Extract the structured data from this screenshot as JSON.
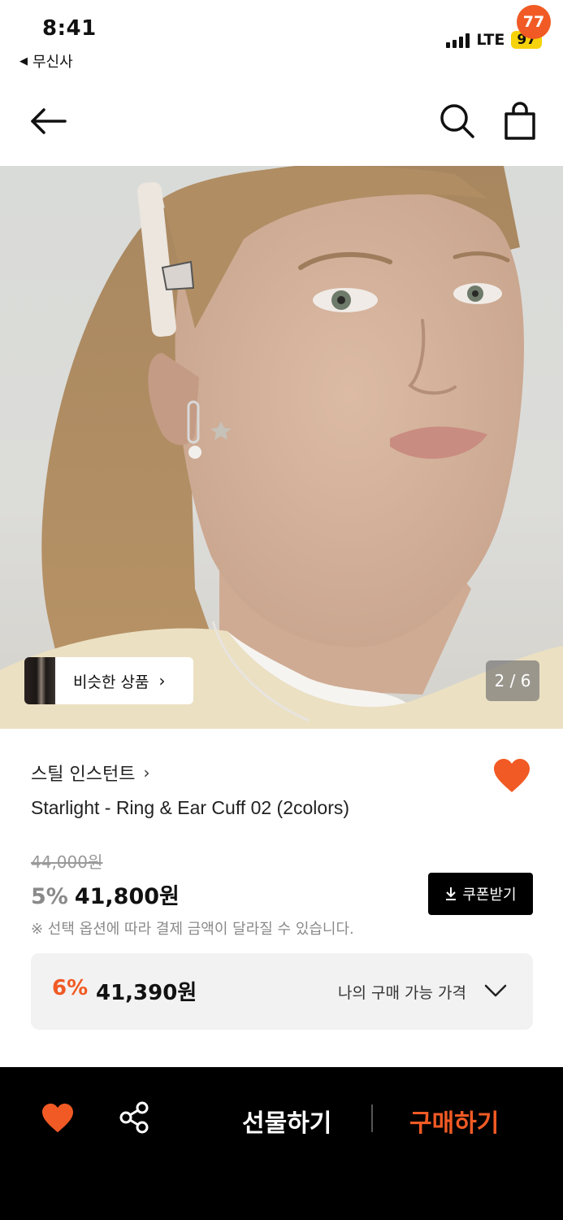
{
  "status_bar": {
    "time": "8:41",
    "back_app": "무신사",
    "network": "LTE",
    "battery": "97"
  },
  "nav": {
    "cart_badge": "77",
    "icons": [
      "back-arrow-icon",
      "search-icon",
      "shopping-bag-icon"
    ]
  },
  "gallery": {
    "similar_label": "비슷한 상품",
    "counter": "2 / 6"
  },
  "product": {
    "brand": "스틸 인스턴트",
    "title": "Starlight - Ring & Ear Cuff 02 (2colors)",
    "original_price": "44,000원",
    "discount_rate": "5%",
    "sale_price": "41,800원",
    "coupon_label": "쿠폰받기",
    "notice": "※ 선택 옵션에 따라 결제 금액이 달라질 수 있습니다."
  },
  "my_price": {
    "rate": "6%",
    "price": "41,390원",
    "label": "나의 구매 가능 가격"
  },
  "bottom_bar": {
    "gift_label": "선물하기",
    "buy_label": "구매하기"
  },
  "colors": {
    "accent": "#f15a24",
    "black": "#000000",
    "battery": "#f5d20a"
  }
}
